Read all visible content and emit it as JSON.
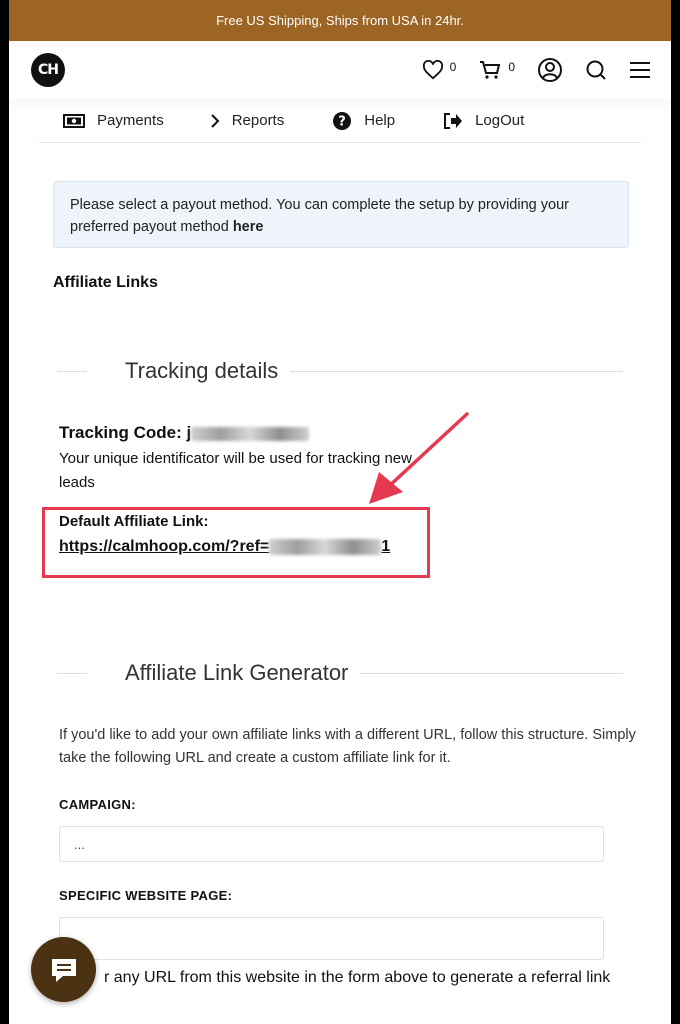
{
  "promo_bar": {
    "text": "Free US Shipping, Ships from USA in 24hr."
  },
  "header": {
    "logo_text": "CH",
    "wishlist_count": "0",
    "cart_count": "0"
  },
  "subnav": {
    "items": [
      {
        "label": "Payments",
        "icon": "payments-icon"
      },
      {
        "label": "Reports",
        "icon": "chevron-right-icon"
      },
      {
        "label": "Help",
        "icon": "help-icon"
      },
      {
        "label": "LogOut",
        "icon": "logout-icon"
      }
    ]
  },
  "notice": {
    "text": "Please select a payout method. You can complete the setup by providing your preferred payout method ",
    "link": "here"
  },
  "affiliate_links_title": "Affiliate Links",
  "tracking": {
    "heading": "Tracking details",
    "code_label": "Tracking Code:",
    "code_prefix": "j",
    "description": "Your unique identificator will be used for tracking new leads",
    "default_label": "Default Affiliate Link:",
    "default_link_prefix": "https://calmhoop.com/?ref=",
    "default_link_suffix": "1"
  },
  "generator": {
    "heading": "Affiliate Link Generator",
    "description": "If you'd like to add your own affiliate links with a different URL, follow this structure. Simply take the following URL and create a custom affiliate link for it.",
    "campaign_label": "CAMPAIGN:",
    "campaign_value": "...",
    "page_label": "SPECIFIC WEBSITE PAGE:",
    "page_value": "",
    "note": "r any URL from this website in the form above to generate a referral link"
  },
  "colors": {
    "promo_bg": "#9c6524",
    "highlight_red": "#e53950",
    "chat_bg": "#4a3212",
    "notice_bg": "#eef4f9"
  }
}
